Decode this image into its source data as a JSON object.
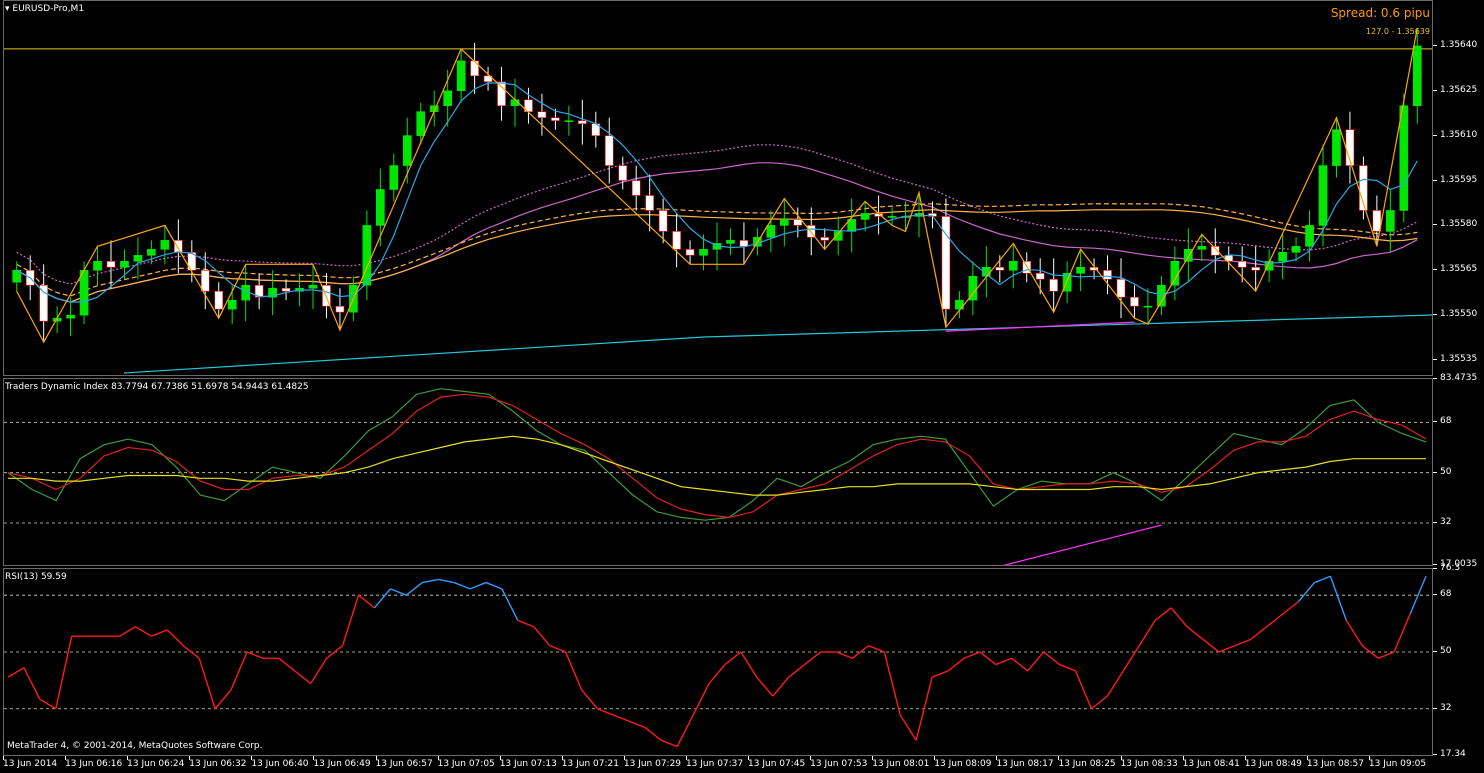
{
  "window": {
    "title": "EURUSD-Pro,M1",
    "spread": "Spread: 0.6 pipu",
    "fib_label": "127.0 - 1.35639",
    "copyright": "MetaTrader 4, © 2001-2014, MetaQuotes Software Corp."
  },
  "price_axis": [
    "1.35640",
    "1.35625",
    "1.35610",
    "1.35595",
    "1.35580",
    "1.35565",
    "1.35550",
    "1.35535"
  ],
  "tdi": {
    "title": "Traders Dynamic Index 83.7794 67.7386 51.6978 54.9443 61.4825",
    "axis": [
      "83.4735",
      "68",
      "50",
      "32",
      "17.0035"
    ]
  },
  "rsi": {
    "title": "RSI(13) 59.59",
    "axis": [
      "76.3",
      "68",
      "50",
      "32",
      "17.34"
    ]
  },
  "time_axis": [
    "13 Jun 2014",
    "13 Jun 06:16",
    "13 Jun 06:24",
    "13 Jun 06:32",
    "13 Jun 06:40",
    "13 Jun 06:49",
    "13 Jun 06:57",
    "13 Jun 07:05",
    "13 Jun 07:13",
    "13 Jun 07:21",
    "13 Jun 07:29",
    "13 Jun 07:37",
    "13 Jun 07:45",
    "13 Jun 07:53",
    "13 Jun 08:01",
    "13 Jun 08:09",
    "13 Jun 08:17",
    "13 Jun 08:25",
    "13 Jun 08:33",
    "13 Jun 08:41",
    "13 Jun 08:49",
    "13 Jun 08:57",
    "13 Jun 09:05"
  ],
  "colors": {
    "bull": "#00e600",
    "bear": "#ffffff",
    "bear_edge": "#ff0000",
    "zigzag": "#ffa500",
    "fib": "#e8c51b",
    "ma_fast": "#2aa6e6",
    "ma_purple": "#cc66cc",
    "ma_orange": "#ffb347",
    "ma_cyan": "#22c8d8",
    "tdi_green": "#3a9a3a",
    "tdi_red": "#e02020",
    "tdi_yellow": "#e8e020",
    "rsi_red": "#ff1a1a",
    "rsi_blue": "#3399ff",
    "divergence": "#ff33ff"
  },
  "chart_data": [
    {
      "type": "candlestick",
      "title": "EURUSD-Pro,M1",
      "ylim": [
        1.3553,
        1.35655
      ],
      "close": [
        1.35565,
        1.3556,
        1.35548,
        1.35549,
        1.3555,
        1.35565,
        1.35568,
        1.35566,
        1.35568,
        1.3557,
        1.35572,
        1.35575,
        1.35571,
        1.35565,
        1.35558,
        1.35552,
        1.35555,
        1.3556,
        1.35556,
        1.35559,
        1.35558,
        1.35559,
        1.3556,
        1.35553,
        1.35551,
        1.3556,
        1.3558,
        1.35592,
        1.356,
        1.3561,
        1.35618,
        1.3562,
        1.35625,
        1.35635,
        1.3563,
        1.35628,
        1.3562,
        1.35622,
        1.35618,
        1.35616,
        1.35615,
        1.35615,
        1.35614,
        1.3561,
        1.356,
        1.35595,
        1.3559,
        1.35585,
        1.35578,
        1.35572,
        1.3557,
        1.35572,
        1.35574,
        1.35575,
        1.35573,
        1.35576,
        1.3558,
        1.35582,
        1.3558,
        1.35576,
        1.35575,
        1.35578,
        1.35582,
        1.35584,
        1.35583,
        1.35583,
        1.35583,
        1.35584,
        1.35583,
        1.35552,
        1.35555,
        1.35563,
        1.35566,
        1.35565,
        1.35568,
        1.35564,
        1.35562,
        1.35558,
        1.35564,
        1.35566,
        1.35565,
        1.35562,
        1.35556,
        1.35553,
        1.35553,
        1.3556,
        1.35568,
        1.35572,
        1.35573,
        1.3557,
        1.35568,
        1.35566,
        1.35565,
        1.35568,
        1.35571,
        1.35573,
        1.3558,
        1.356,
        1.35612,
        1.356,
        1.35585,
        1.35578,
        1.35585,
        1.3562,
        1.3564
      ]
    },
    {
      "type": "line",
      "title": "Traders Dynamic Index",
      "ylim": [
        17.0035,
        83.4735
      ],
      "series": [
        {
          "values": [
            50,
            44,
            40,
            55,
            60,
            62,
            60,
            52,
            42,
            40,
            46,
            52,
            50,
            48,
            56,
            65,
            70,
            78,
            80,
            79,
            78,
            72,
            65,
            60,
            58,
            50,
            42,
            36,
            34,
            33,
            34,
            40,
            48,
            45,
            50,
            54,
            60,
            62,
            63,
            62,
            50,
            38,
            44,
            47,
            46,
            46,
            50,
            46,
            40,
            48,
            56,
            64,
            62,
            60,
            66,
            74,
            76,
            68,
            64,
            61
          ]
        },
        {
          "values": [
            50,
            48,
            44,
            48,
            56,
            59,
            58,
            54,
            47,
            44,
            44,
            48,
            49,
            49,
            52,
            58,
            64,
            72,
            77,
            78,
            77,
            74,
            69,
            64,
            60,
            55,
            48,
            41,
            37,
            35,
            34,
            36,
            42,
            44,
            46,
            51,
            56,
            60,
            62,
            61,
            56,
            46,
            44,
            45,
            46,
            46,
            47,
            46,
            43,
            45,
            51,
            58,
            61,
            61,
            63,
            69,
            72,
            69,
            67,
            62
          ]
        },
        {
          "values": [
            48,
            48,
            47,
            47,
            48,
            49,
            49,
            49,
            48,
            48,
            47,
            47,
            48,
            49,
            50,
            52,
            55,
            57,
            59,
            61,
            62,
            63,
            62,
            60,
            57,
            54,
            51,
            48,
            45,
            44,
            43,
            42,
            42,
            43,
            44,
            45,
            45,
            46,
            46,
            46,
            46,
            45,
            44,
            44,
            44,
            44,
            45,
            45,
            44,
            45,
            46,
            48,
            50,
            51,
            52,
            54,
            55,
            55,
            55,
            55
          ]
        }
      ]
    },
    {
      "type": "line",
      "title": "RSI(13) 59.59",
      "ylim": [
        17.34,
        76.3
      ],
      "values": [
        42,
        45,
        35,
        32,
        55,
        55,
        55,
        55,
        58,
        55,
        57,
        52,
        48,
        32,
        38,
        50,
        48,
        48,
        44,
        40,
        48,
        52,
        68,
        64,
        70,
        68,
        72,
        73,
        72,
        70,
        72,
        70,
        60,
        58,
        52,
        50,
        38,
        32,
        30,
        28,
        26,
        22,
        20,
        30,
        40,
        46,
        50,
        42,
        36,
        42,
        46,
        50,
        50,
        48,
        52,
        50,
        30,
        22,
        42,
        44,
        48,
        50,
        46,
        48,
        44,
        50,
        46,
        44,
        32,
        36,
        44,
        52,
        60,
        64,
        58,
        54,
        50,
        52,
        54,
        58,
        62,
        66,
        72,
        74,
        60,
        52,
        48,
        50,
        62,
        74
      ]
    }
  ]
}
